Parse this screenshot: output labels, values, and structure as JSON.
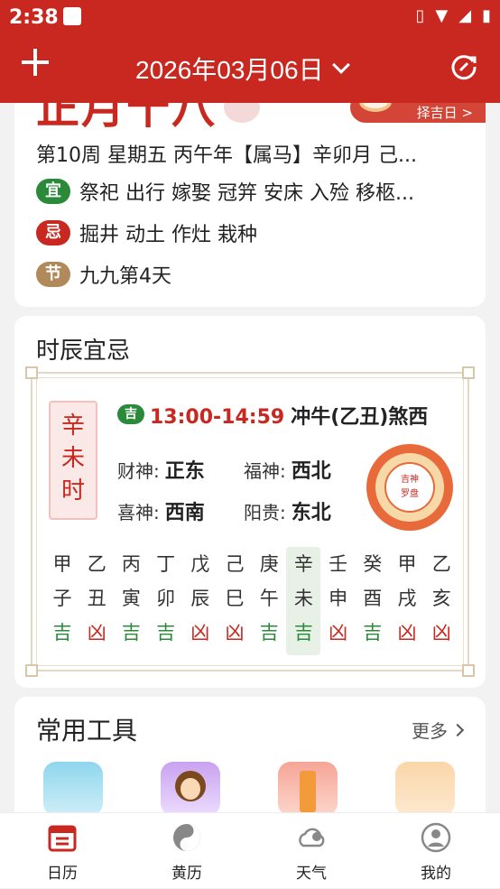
{
  "status_bar": {
    "time": "2:38"
  },
  "header": {
    "date": "2026年03月06日"
  },
  "day_card": {
    "lunar_date": "正月十八",
    "zeji_label": "择吉日 >",
    "week_line": "第10周 星期五 丙午年【属马】辛卯月 己...",
    "yi_badge": "宜",
    "yi_text": "祭祀 出行 嫁娶 冠笄 安床 入殓 移柩...",
    "ji_badge": "忌",
    "ji_text": "掘井 动土 作灶 栽种",
    "jie_badge": "节",
    "jie_text": "九九第4天"
  },
  "shichen": {
    "title": "时辰宜忌",
    "current_shi": [
      "辛",
      "未",
      "时"
    ],
    "ji_badge": "吉",
    "time_range": "13:00-14:59",
    "chong": "冲牛(乙丑)煞西",
    "caishen_label": "财神:",
    "caishen_value": "正东",
    "fushen_label": "福神:",
    "fushen_value": "西北",
    "xishen_label": "喜神:",
    "xishen_value": "西南",
    "yanggui_label": "阳贵:",
    "yanggui_value": "东北",
    "luopan_text": [
      "吉神",
      "罗盘"
    ],
    "hours": [
      {
        "gan": "甲",
        "zhi": "子",
        "luck": "吉"
      },
      {
        "gan": "乙",
        "zhi": "丑",
        "luck": "凶"
      },
      {
        "gan": "丙",
        "zhi": "寅",
        "luck": "吉"
      },
      {
        "gan": "丁",
        "zhi": "卯",
        "luck": "吉"
      },
      {
        "gan": "戊",
        "zhi": "辰",
        "luck": "凶"
      },
      {
        "gan": "己",
        "zhi": "巳",
        "luck": "凶"
      },
      {
        "gan": "庚",
        "zhi": "午",
        "luck": "吉"
      },
      {
        "gan": "辛",
        "zhi": "未",
        "luck": "吉"
      },
      {
        "gan": "壬",
        "zhi": "申",
        "luck": "凶"
      },
      {
        "gan": "癸",
        "zhi": "酉",
        "luck": "吉"
      },
      {
        "gan": "甲",
        "zhi": "戌",
        "luck": "凶"
      },
      {
        "gan": "乙",
        "zhi": "亥",
        "luck": "凶"
      }
    ]
  },
  "tools": {
    "title": "常用工具",
    "more": "更多"
  },
  "bottom_nav": {
    "items": [
      {
        "label": "日历",
        "icon": "calendar-icon"
      },
      {
        "label": "黄历",
        "icon": "yinyang-icon"
      },
      {
        "label": "天气",
        "icon": "weather-icon"
      },
      {
        "label": "我的",
        "icon": "profile-icon"
      }
    ]
  },
  "colors": {
    "brand_red": "#c8281f",
    "ji_green": "#2a8a3a",
    "jie_tan": "#b08a5a"
  }
}
